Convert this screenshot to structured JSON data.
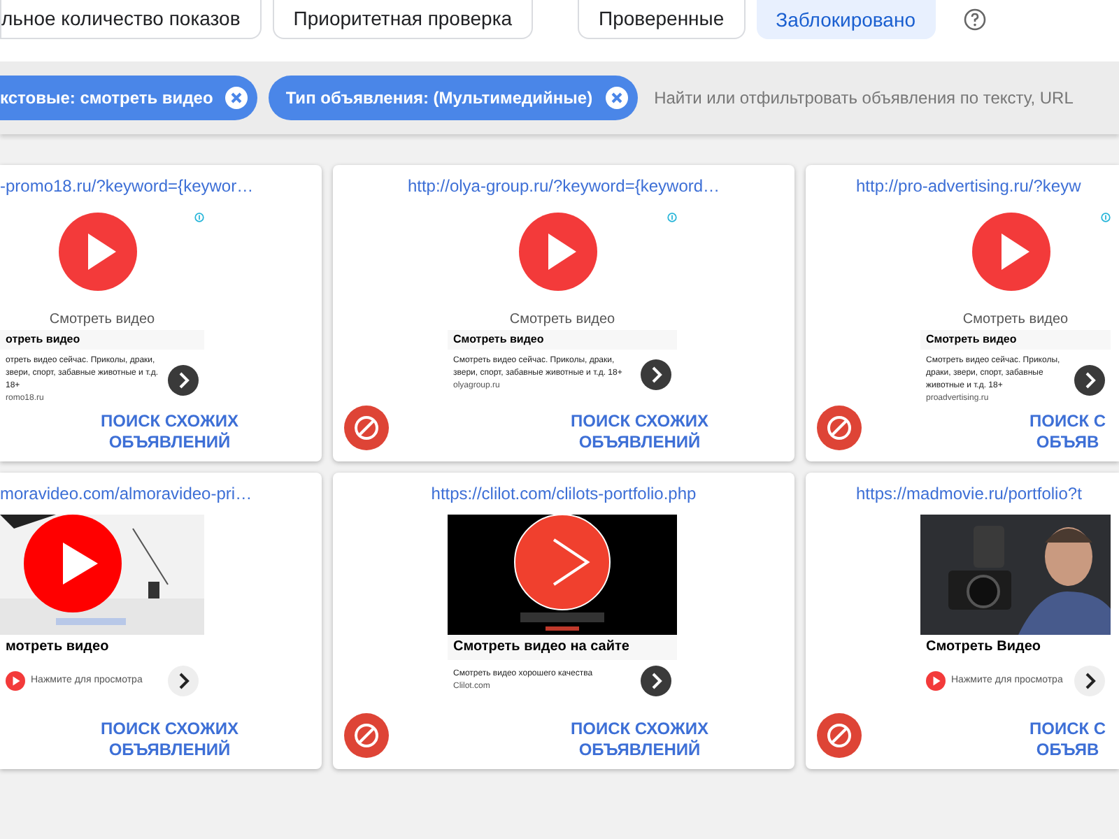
{
  "tabs": [
    {
      "label": "льное количество показов",
      "selected": false
    },
    {
      "label": "Приоритетная проверка",
      "selected": false
    },
    {
      "label": "Проверенные",
      "selected": false
    },
    {
      "label": "Заблокировано",
      "selected": true
    }
  ],
  "filters": {
    "chips": [
      "кстовые: смотреть видео",
      "Тип объявления: (Мультимедийные)"
    ],
    "search": {
      "placeholder": "Найти или отфильтровать объявления по тексту, URL"
    }
  },
  "cards": [
    {
      "url": "-promo18.ru/?keyword={keywor…",
      "similar": [
        "ПОИСК СХОЖИХ",
        "ОБЪЯВЛЕНИЙ"
      ],
      "creative": {
        "kind": "html",
        "caption": "Смотреть видео",
        "title": "отреть видео",
        "desc": "отреть видео сейчас. Приколы, драки, звери, спорт, забавные животные и т.д. 18+",
        "domain": "romo18.ru"
      }
    },
    {
      "url": "http://olya-group.ru/?keyword={keyword…",
      "similar": [
        "ПОИСК СХОЖИХ",
        "ОБЪЯВЛЕНИЙ"
      ],
      "creative": {
        "kind": "html",
        "caption": "Смотреть видео",
        "title": "Смотреть видео",
        "desc": "Смотреть видео сейчас. Приколы, драки, звери, спорт, забавные животные и т.д. 18+",
        "domain": "olyagroup.ru"
      }
    },
    {
      "url": "http://pro-advertising.ru/?keyw",
      "similar": [
        "ПОИСК С",
        "ОБЪЯВ"
      ],
      "creative": {
        "kind": "html",
        "caption": "Смотреть видео",
        "title": "Смотреть видео",
        "desc": "Смотреть видео сейчас. Приколы, драки, звери, спорт, забавные животные и т.д. 18+",
        "domain": "proadvertising.ru"
      }
    },
    {
      "url": "moravideo.com/almoravideo-pri…",
      "similar": [
        "ПОИСК СХОЖИХ",
        "ОБЪЯВЛЕНИЙ"
      ],
      "creative": {
        "title": "мотреть видео",
        "cta": "Нажмите для просмотра"
      }
    },
    {
      "url": "https://clilot.com/clilots-portfolio.php",
      "similar": [
        "ПОИСК СХОЖИХ",
        "ОБЪЯВЛЕНИЙ"
      ],
      "creative": {
        "title": "Смотреть видео на сайте",
        "desc": "Смотреть видео хорошего качества",
        "domain": "Clilot.com"
      }
    },
    {
      "url": "https://madmovie.ru/portfolio?t",
      "similar": [
        "ПОИСК С",
        "ОБЪЯВ"
      ],
      "creative": {
        "title": "Смотреть Видео",
        "cta": "Нажмите для просмотра"
      }
    }
  ]
}
